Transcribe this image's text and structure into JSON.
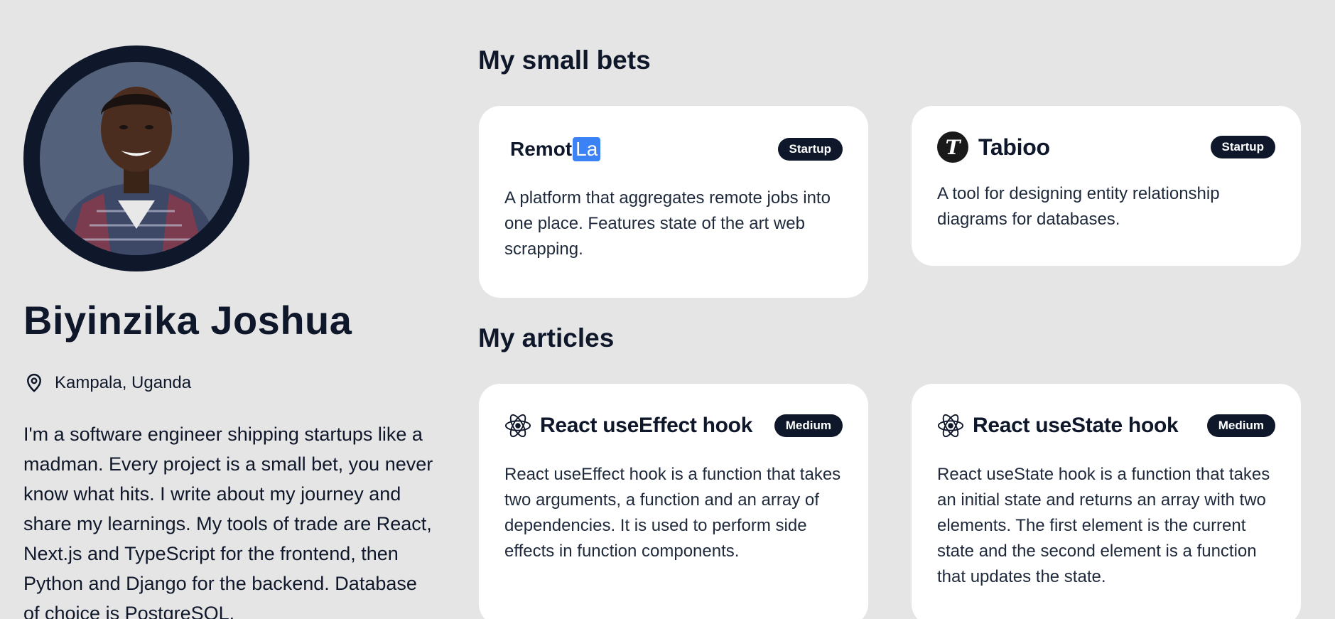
{
  "profile": {
    "name": "Biyinzika Joshua",
    "location": "Kampala, Uganda",
    "bio": "I'm a software engineer shipping startups like a madman. Every project is a small bet, you never know what hits. I write about my journey and share my learnings. My tools of trade are React, Next.js and TypeScript for the frontend, then Python and Django for the backend. Database of choice is PostgreSQL."
  },
  "bets": {
    "title": "My small bets",
    "items": [
      {
        "logo_text": "Remot",
        "logo_box": "La",
        "badge": "Startup",
        "description": "A platform that aggregates remote jobs into one place. Features state of the art web scrapping."
      },
      {
        "logo_icon": "T",
        "name": "Tabioo",
        "badge": "Startup",
        "description": "A tool for designing entity relationship diagrams for databases."
      }
    ]
  },
  "articles": {
    "title": "My articles",
    "items": [
      {
        "icon": "react-icon",
        "title": "React useEffect hook",
        "badge": "Medium",
        "description": "React useEffect hook is a function that takes two arguments, a function and an array of dependencies. It is used to perform side effects in function components."
      },
      {
        "icon": "react-icon",
        "title": "React useState hook",
        "badge": "Medium",
        "description": "React useState hook is a function that takes an initial state and returns an array with two elements. The first element is the current state and the second element is a function that updates the state."
      }
    ]
  },
  "colors": {
    "background": "#e5e5e5",
    "primary": "#0f172a",
    "card": "#ffffff",
    "remotla_accent": "#3b82f6"
  }
}
